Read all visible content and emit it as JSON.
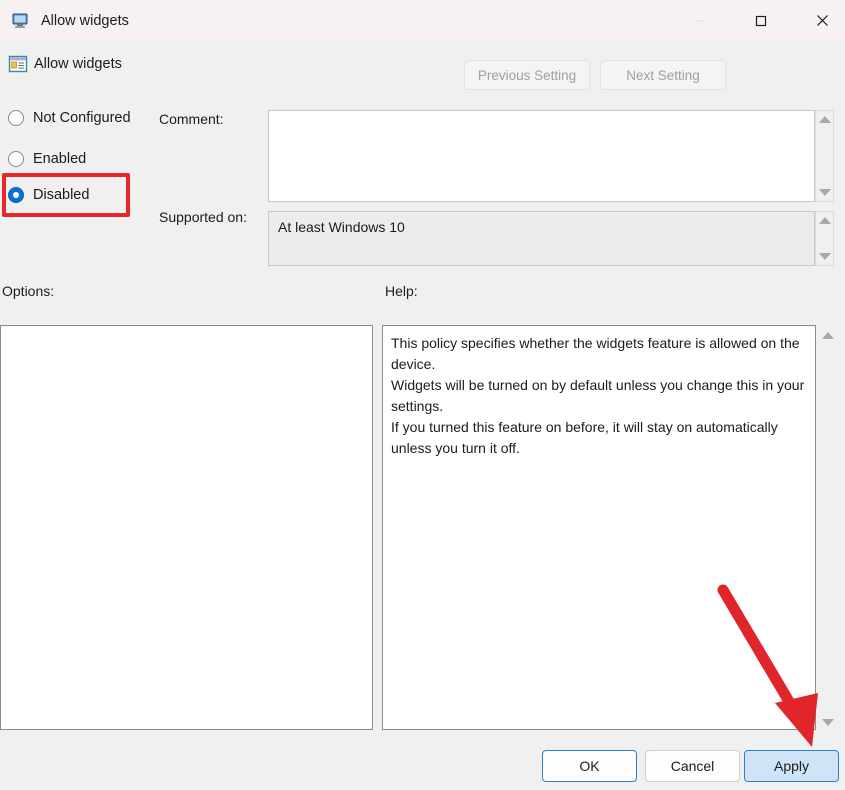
{
  "window": {
    "title": "Allow widgets",
    "title_icon": "computer-monitor-icon",
    "controls": {
      "minimize": "minimize-icon",
      "maximize": "maximize-icon",
      "close": "close-icon"
    }
  },
  "policy_header": {
    "icon": "policy-setting-icon",
    "name": "Allow widgets",
    "previous_button": "Previous Setting",
    "next_button": "Next Setting"
  },
  "state": {
    "options": [
      {
        "label": "Not Configured",
        "selected": false
      },
      {
        "label": "Enabled",
        "selected": false
      },
      {
        "label": "Disabled",
        "selected": true
      }
    ]
  },
  "comment": {
    "label": "Comment:",
    "value": ""
  },
  "supported": {
    "label": "Supported on:",
    "value": "At least Windows 10"
  },
  "panels": {
    "options_label": "Options:",
    "options_content": "",
    "help_label": "Help:",
    "help_paragraphs": [
      "This policy specifies whether the widgets feature is allowed on the device.",
      "Widgets will be turned on by default unless you change this in your settings.",
      "If you turned this feature on before, it will stay on automatically unless you turn it off."
    ]
  },
  "footer": {
    "ok": "OK",
    "cancel": "Cancel",
    "apply": "Apply"
  },
  "annotations": {
    "highlight_color": "#e8252a",
    "highlight_target": "Disabled",
    "arrow_color": "#e0262b",
    "arrow_target": "Apply"
  }
}
